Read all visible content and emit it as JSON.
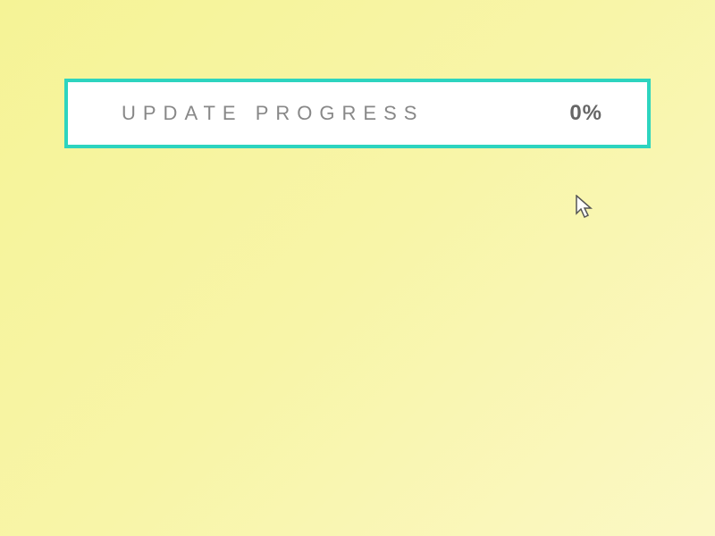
{
  "progress": {
    "label": "UPDATE PROGRESS",
    "value": "0%"
  }
}
